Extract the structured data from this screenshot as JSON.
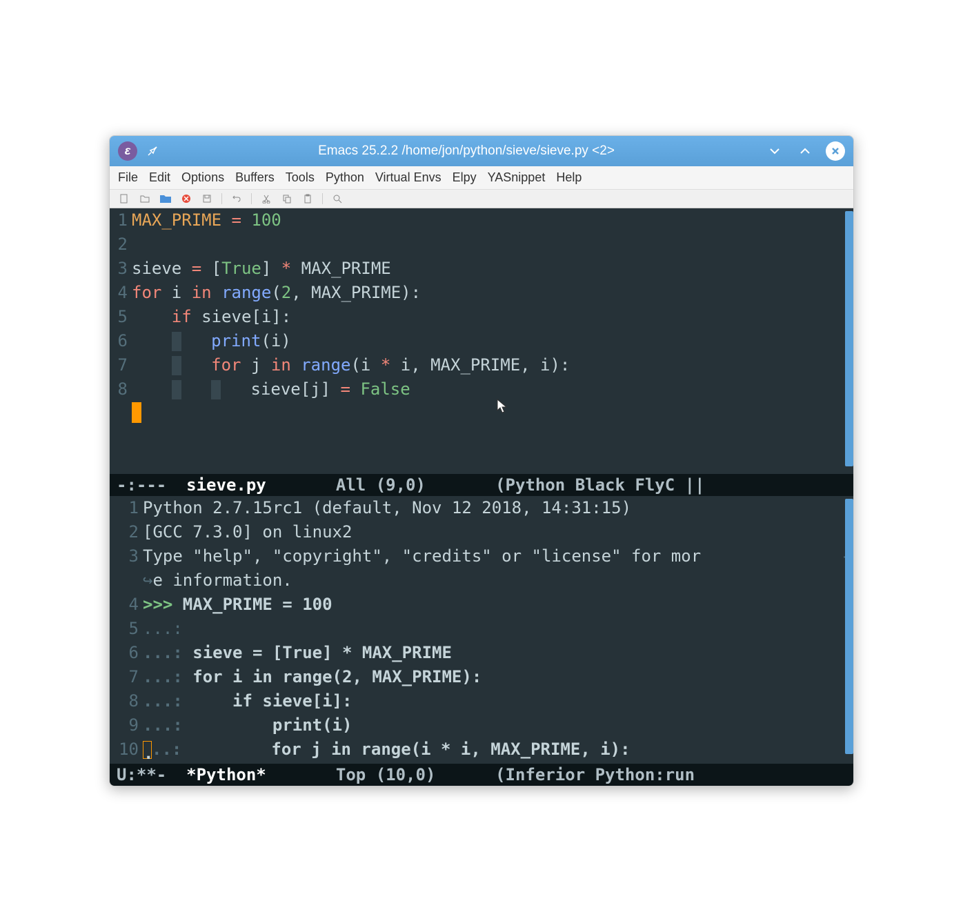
{
  "window": {
    "title": "Emacs 25.2.2 /home/jon/python/sieve/sieve.py <2>",
    "app_icon": "ε"
  },
  "menubar": {
    "items": [
      "File",
      "Edit",
      "Options",
      "Buffers",
      "Tools",
      "Python",
      "Virtual Envs",
      "Elpy",
      "YASnippet",
      "Help"
    ]
  },
  "toolbar": {
    "icons": [
      "new-file",
      "open-folder",
      "folder-blue",
      "close-red",
      "save",
      "sep",
      "undo",
      "sep",
      "cut",
      "copy",
      "paste",
      "sep",
      "search"
    ]
  },
  "pane1": {
    "lines": [
      {
        "n": "1",
        "tokens": [
          [
            "MAX_PRIME",
            "orange"
          ],
          [
            " ",
            ""
          ],
          [
            "=",
            "coral"
          ],
          [
            " ",
            ""
          ],
          [
            "100",
            "green"
          ]
        ]
      },
      {
        "n": "2",
        "tokens": []
      },
      {
        "n": "3",
        "tokens": [
          [
            "sieve ",
            ""
          ],
          [
            "=",
            "coral"
          ],
          [
            " [",
            ""
          ],
          [
            "True",
            "green"
          ],
          [
            "] ",
            ""
          ],
          [
            "*",
            "coral"
          ],
          [
            " MAX_PRIME",
            ""
          ]
        ]
      },
      {
        "n": "4",
        "tokens": [
          [
            "for",
            "coral"
          ],
          [
            " i ",
            ""
          ],
          [
            "in",
            "coral"
          ],
          [
            " ",
            ""
          ],
          [
            "range",
            "blue"
          ],
          [
            "(",
            ""
          ],
          [
            "2",
            "green"
          ],
          [
            ", MAX_PRIME):",
            ""
          ]
        ]
      },
      {
        "n": "5",
        "tokens": [
          [
            "    ",
            ""
          ],
          [
            "if",
            "coral"
          ],
          [
            " sieve[i]:",
            ""
          ]
        ]
      },
      {
        "n": "6",
        "tokens": [
          [
            "    ",
            ""
          ],
          [
            "GUIDE",
            "g"
          ],
          [
            "   ",
            ""
          ],
          [
            "print",
            "blue"
          ],
          [
            "(i)",
            ""
          ]
        ]
      },
      {
        "n": "7",
        "tokens": [
          [
            "    ",
            ""
          ],
          [
            "GUIDE",
            "g"
          ],
          [
            "   ",
            ""
          ],
          [
            "for",
            "coral"
          ],
          [
            " j ",
            ""
          ],
          [
            "in",
            "coral"
          ],
          [
            " ",
            ""
          ],
          [
            "range",
            "blue"
          ],
          [
            "(i ",
            ""
          ],
          [
            "*",
            "coral"
          ],
          [
            " i, MAX_PRIME, i):",
            ""
          ]
        ]
      },
      {
        "n": "8",
        "tokens": [
          [
            "    ",
            ""
          ],
          [
            "GUIDE",
            "g"
          ],
          [
            "   ",
            ""
          ],
          [
            "GUIDE",
            "g"
          ],
          [
            "   sieve[j] ",
            ""
          ],
          [
            "=",
            "coral"
          ],
          [
            " ",
            ""
          ],
          [
            "False",
            "green"
          ]
        ]
      },
      {
        "n": "",
        "tokens": [
          [
            "CURSOR",
            "cursor"
          ]
        ]
      }
    ],
    "modeline_left": "-:---  ",
    "modeline_fname": "sieve.py",
    "modeline_mid": "       All (9,0)       ",
    "modeline_right": "(Python Black FlyC ||"
  },
  "pane2": {
    "lines": [
      {
        "n": "1",
        "text": "Python 2.7.15rc1 (default, Nov 12 2018, 14:31:15)"
      },
      {
        "n": "2",
        "text": "[GCC 7.3.0] on linux2"
      },
      {
        "n": "3",
        "text": "Type \"help\", \"copyright\", \"credits\" or \"license\" for mor",
        "arrow": true
      },
      {
        "n": "",
        "wrap": true,
        "text": "e information."
      },
      {
        "n": "4",
        "prompt": ">>> ",
        "rest": "MAX_PRIME = 100",
        "bold": true
      },
      {
        "n": "5",
        "cont": "...: ",
        "rest": ""
      },
      {
        "n": "6",
        "cont": "...: ",
        "rest": "sieve = [True] * MAX_PRIME",
        "bold": true
      },
      {
        "n": "7",
        "cont": "...: ",
        "rest": "for i in range(2, MAX_PRIME):",
        "bold": true
      },
      {
        "n": "8",
        "cont": "...: ",
        "rest": "    if sieve[i]:",
        "bold": true
      },
      {
        "n": "9",
        "cont": "...: ",
        "rest": "        print(i)",
        "bold": true
      },
      {
        "n": "10",
        "cont": "...: ",
        "rest": "        for j in range(i * i, MAX_PRIME, i):",
        "bold": true,
        "cursor_box": true
      }
    ],
    "modeline_left": "U:**-  ",
    "modeline_fname": "*Python*",
    "modeline_mid": "       Top (10,0)      ",
    "modeline_right": "(Inferior Python:run "
  }
}
